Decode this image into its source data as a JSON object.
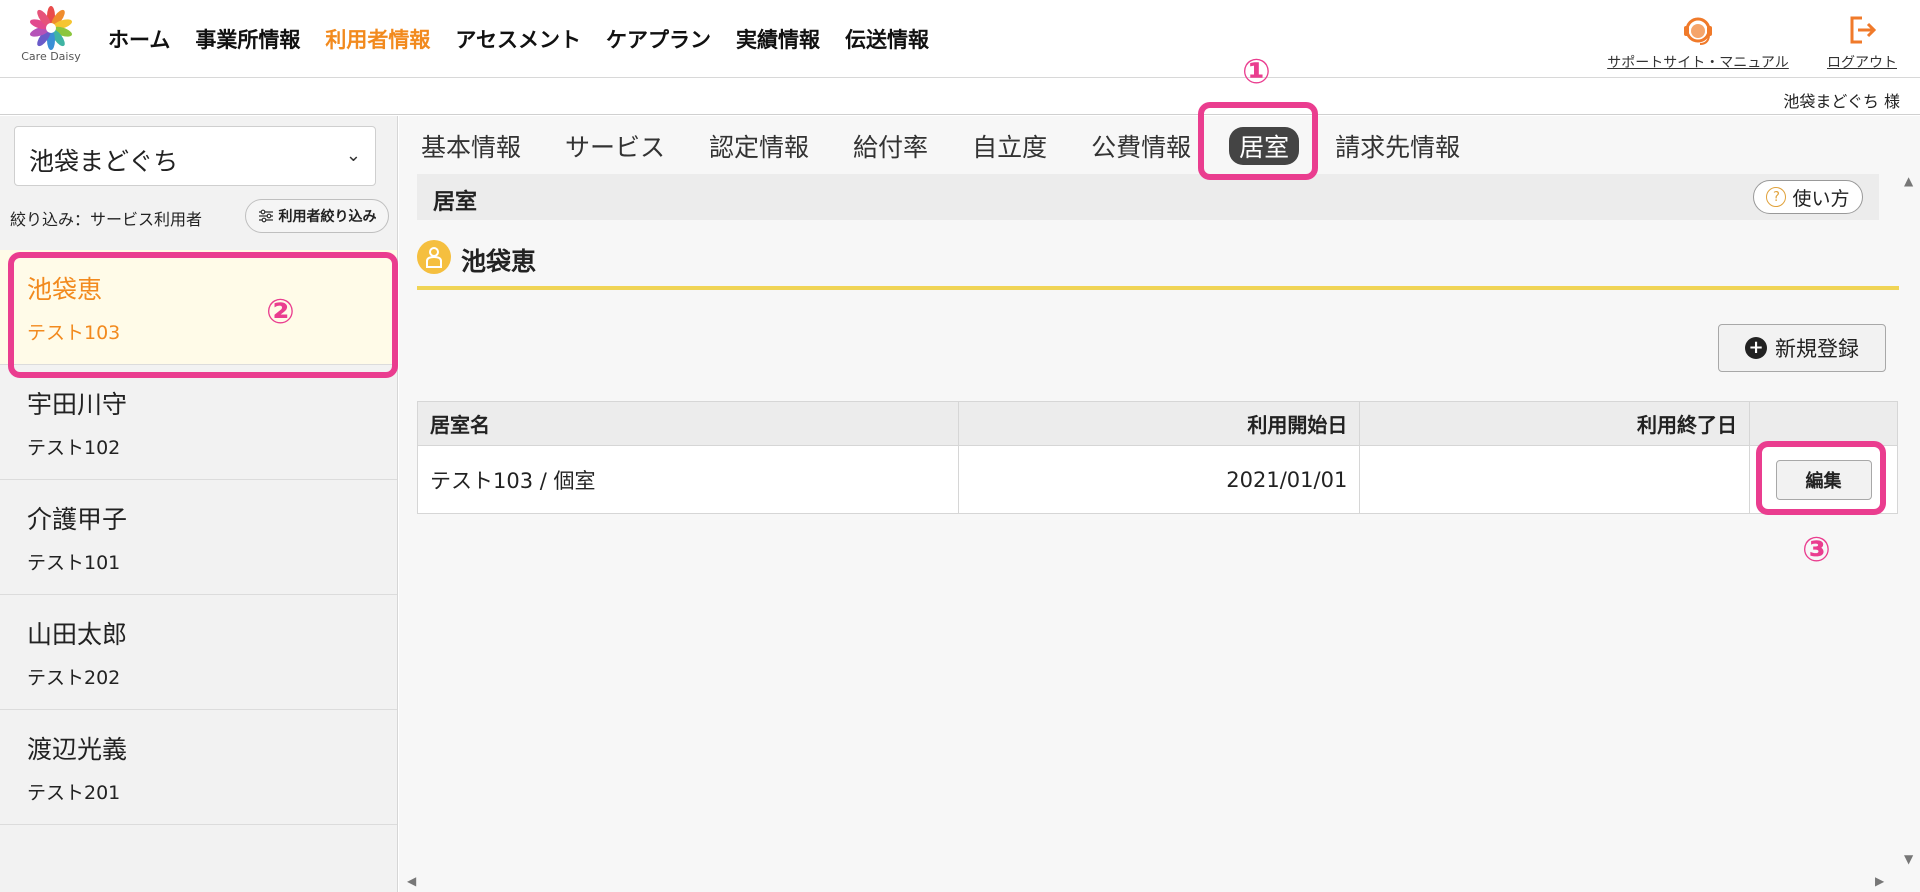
{
  "header": {
    "logo_text": "Care Daisy",
    "nav": [
      "ホーム",
      "事業所情報",
      "利用者情報",
      "アセスメント",
      "ケアプラン",
      "実績情報",
      "伝送情報"
    ],
    "nav_active_index": 2,
    "support_label": "サポートサイト・マニュアル",
    "logout_label": "ログアウト",
    "user_name": "池袋まどぐち 様"
  },
  "sidebar": {
    "facility": "池袋まどぐち",
    "filter_label": "絞り込み：サービス利用者",
    "filter_button": "利用者絞り込み",
    "users": [
      {
        "name": "池袋恵",
        "room": "テスト103",
        "selected": true
      },
      {
        "name": "宇田川守",
        "room": "テスト102"
      },
      {
        "name": "介護甲子",
        "room": "テスト101"
      },
      {
        "name": "山田太郎",
        "room": "テスト202"
      },
      {
        "name": "渡辺光義",
        "room": "テスト201"
      }
    ]
  },
  "main": {
    "tabs": [
      "基本情報",
      "サービス",
      "認定情報",
      "給付率",
      "自立度",
      "公費情報",
      "居室",
      "請求先情報"
    ],
    "active_tab_index": 6,
    "section_title": "居室",
    "howto_label": "使い方",
    "person_name": "池袋恵",
    "new_button": "新規登録",
    "table": {
      "headers": [
        "居室名",
        "利用開始日",
        "利用終了日",
        ""
      ],
      "rows": [
        {
          "room": "テスト103 / 個室",
          "start": "2021/01/01",
          "end": "",
          "action": "編集"
        }
      ]
    }
  },
  "annotations": {
    "a1": "①",
    "a2": "②",
    "a3": "③"
  },
  "colors": {
    "accent_orange": "#f28a1e",
    "highlight_pink": "#ea3d8f",
    "underline_yellow": "#f0d455"
  }
}
